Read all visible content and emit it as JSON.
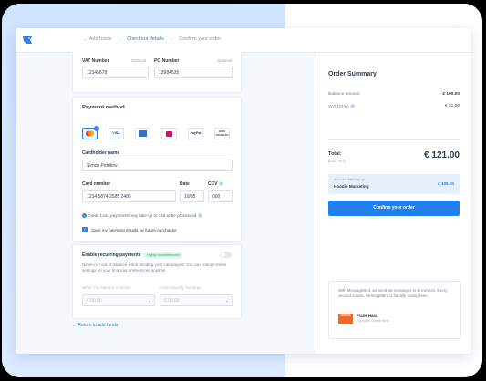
{
  "breadcrumb": {
    "step1": "← Add funds",
    "step2": "Checkout details",
    "step3": "Confirm your order",
    "separator": "→"
  },
  "billing": {
    "vat_label": "VAT Number",
    "vat_optional": "Optional",
    "vat_value": "12345678",
    "po_label": "PO Number",
    "po_optional": "Optional",
    "po_value": "13984535"
  },
  "payment": {
    "title": "Payment method",
    "methods": [
      "Mastercard",
      "VISA",
      "AMEX",
      "iDEAL",
      "PayPal",
      "BANK TRANSFER"
    ],
    "selected_method": "Mastercard",
    "cardholder_label": "Cardholder name",
    "cardholder_value": "Simon Petrikov",
    "card_number_label": "Card number",
    "card_number_value": "1234 5874 2585 2486",
    "date_label": "Date",
    "date_value": "10/35",
    "ccv_label": "CCV",
    "ccv_value": "000",
    "processing_note": "Credit Card payments may take up to 24h to be processed",
    "save_details_label": "Save my payment details for future purchases",
    "save_details_checked": true
  },
  "recurring": {
    "title": "Enable recurring payments",
    "badge": "Highly recommended",
    "enabled": false,
    "description": "Never run out of balance when sending your campaigns! You can change these settings on your financial preferences anytime.",
    "below_label": "When my balance is below",
    "below_value": "€ 00.00",
    "exchange_label": "Automatically recharge",
    "exchange_value": "€ 00.00"
  },
  "back_link": "←  Return to add funds",
  "summary": {
    "title": "Order Summary",
    "balance_label": "Balance amount",
    "balance_value": "€ 100.00",
    "vat_label": "VAT (21%)",
    "vat_value": "€ 21.00",
    "total_label": "Total:",
    "total_sub": "(Incl. VAT)",
    "total_value": "€ 121.00",
    "account_note": "Account after top up",
    "account_name": "Hoodie Marketing",
    "account_value": "€ 105.00",
    "confirm_label": "Confirm your order"
  },
  "testimonial": {
    "quote": "With MessageBird, we send 5K messages to in minutes. Every second counts, MessageBird is literally saving lives.",
    "logo_text": "ARRIVA",
    "name": "Frank Haan",
    "role": "Founder, Online Bird"
  },
  "colors": {
    "accent": "#1f80ee",
    "brand_blue": "#2f7de1",
    "success": "#2aa866"
  }
}
